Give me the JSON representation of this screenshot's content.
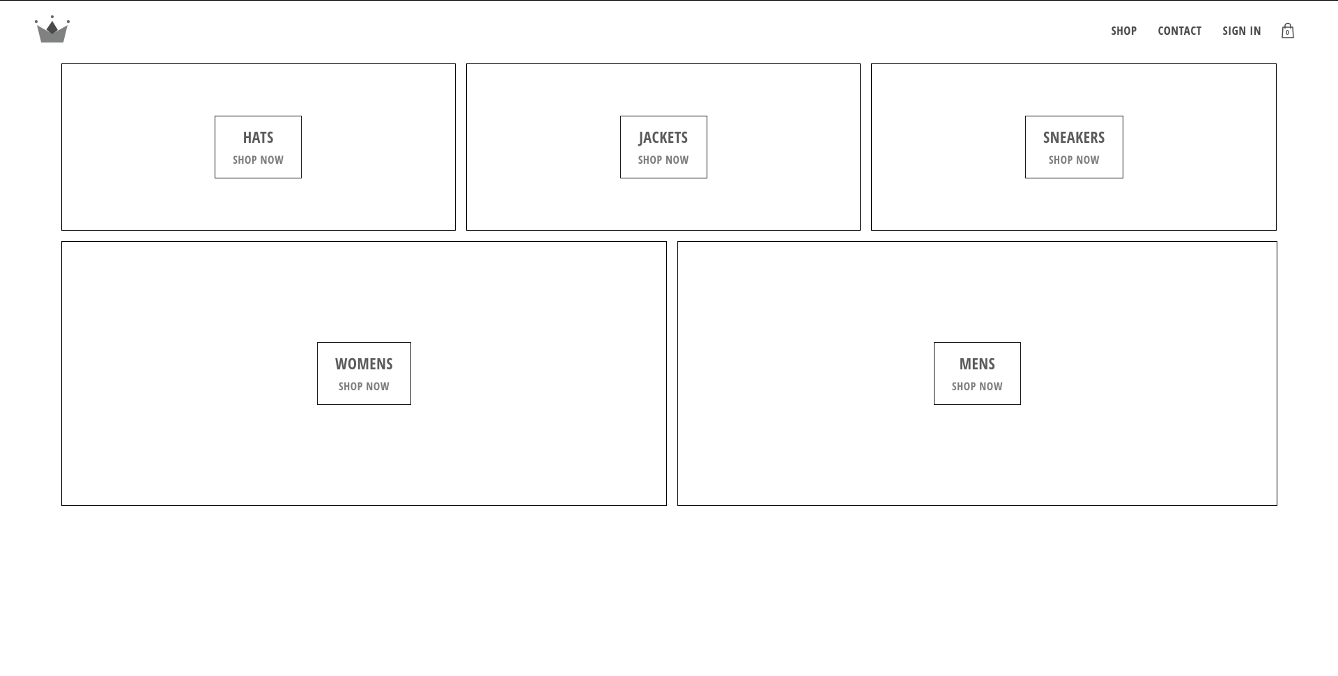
{
  "nav": {
    "shop": "SHOP",
    "contact": "CONTACT",
    "signin": "SIGN IN"
  },
  "cart": {
    "count": "0"
  },
  "categories": [
    {
      "title": "HATS",
      "subtitle": "SHOP NOW",
      "size": ""
    },
    {
      "title": "JACKETS",
      "subtitle": "SHOP NOW",
      "size": ""
    },
    {
      "title": "SNEAKERS",
      "subtitle": "SHOP NOW",
      "size": ""
    },
    {
      "title": "WOMENS",
      "subtitle": "SHOP NOW",
      "size": "large"
    },
    {
      "title": "MENS",
      "subtitle": "SHOP NOW",
      "size": "large"
    }
  ]
}
